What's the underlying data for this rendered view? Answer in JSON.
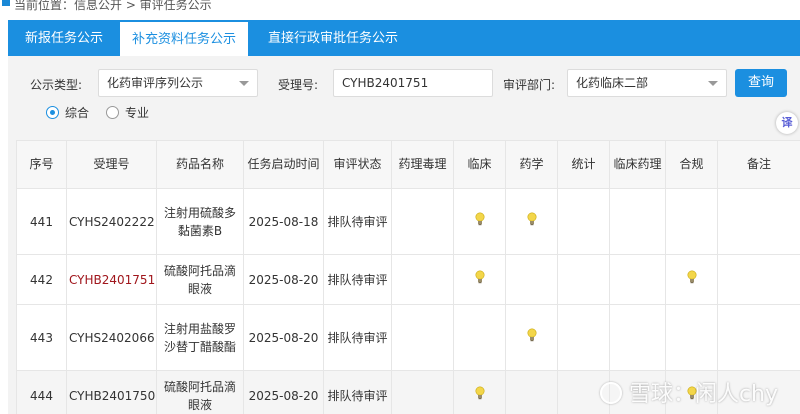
{
  "breadcrumb": {
    "text": "当前位置：信息公开 > 审评任务公示"
  },
  "tabs": [
    {
      "label": "新报任务公示",
      "active": false
    },
    {
      "label": "补充资料任务公示",
      "active": true
    },
    {
      "label": "直接行政审批任务公示",
      "active": false
    }
  ],
  "filters": {
    "type_label": "公示类型:",
    "type_value": "化药审评序列公示",
    "accept_label": "受理号:",
    "accept_value": "CYHB2401751",
    "dept_label": "审评部门:",
    "dept_value": "化药临床二部",
    "query_label": "查询",
    "radio_comprehensive": "综合",
    "radio_specialty": "专业",
    "selected_radio": "综合"
  },
  "side_badge": "译",
  "table": {
    "headers": [
      "序号",
      "受理号",
      "药品名称",
      "任务启动时间",
      "审评状态",
      "药理毒理",
      "临床",
      "药学",
      "统计",
      "临床药理",
      "合规",
      "备注"
    ],
    "rows": [
      {
        "no": "441",
        "accept": "CYHS2402222",
        "drug": "注射用硫酸多黏菌素B",
        "start": "2025-08-18",
        "status": "排队待审评",
        "tox": false,
        "clinical": true,
        "pharmacy": true,
        "stat": false,
        "clin_pharm": false,
        "compliance": false,
        "note": ""
      },
      {
        "no": "442",
        "accept": "CYHB2401751",
        "drug": "硫酸阿托品滴眼液",
        "start": "2025-08-20",
        "status": "排队待审评",
        "tox": false,
        "clinical": true,
        "pharmacy": false,
        "stat": false,
        "clin_pharm": false,
        "compliance": true,
        "note": ""
      },
      {
        "no": "443",
        "accept": "CYHS2402066",
        "drug": "注射用盐酸罗沙替丁醋酸酯",
        "start": "2025-08-20",
        "status": "排队待审评",
        "tox": false,
        "clinical": false,
        "pharmacy": true,
        "stat": false,
        "clin_pharm": false,
        "compliance": false,
        "note": ""
      },
      {
        "no": "444",
        "accept": "CYHB2401750",
        "drug": "硫酸阿托品滴眼液",
        "start": "2025-08-20",
        "status": "排队待审评",
        "tox": false,
        "clinical": true,
        "pharmacy": false,
        "stat": false,
        "clin_pharm": false,
        "compliance": true,
        "note": ""
      }
    ]
  },
  "watermark": "雪球：闲人chy",
  "colors": {
    "primary": "#1b8fe0",
    "highlight_text": "#a0161c",
    "bulb": "#f3d64a"
  }
}
